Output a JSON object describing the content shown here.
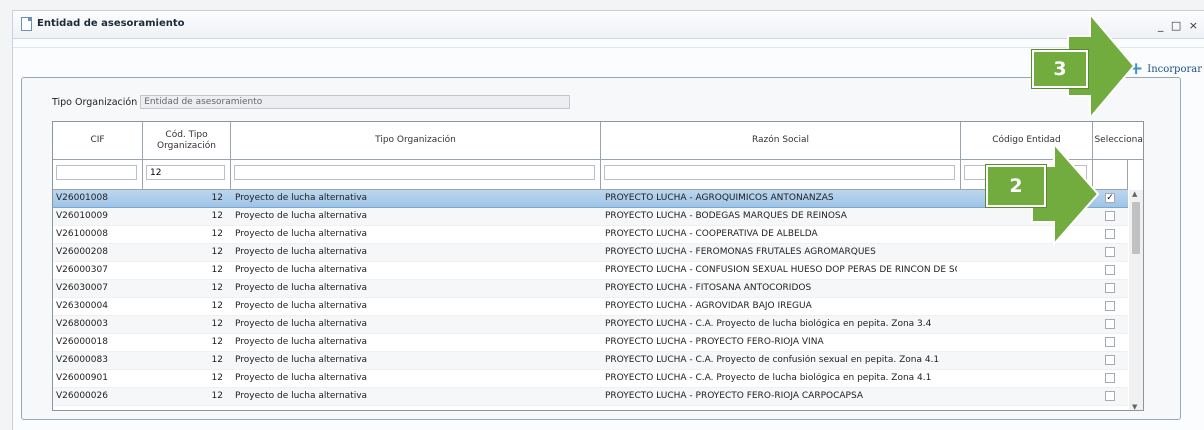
{
  "window": {
    "title": "Entidad de asesoramiento",
    "controls": [
      "_",
      "□",
      "×"
    ]
  },
  "toolbar": {
    "add_label": "Incorporar",
    "add_icon": "plus-icon"
  },
  "filter": {
    "label": "Tipo Organización",
    "value": "Entidad de asesoramiento"
  },
  "grid": {
    "columns": [
      "CIF",
      "Cód. Tipo Organización",
      "Tipo Organización",
      "Razón Social",
      "Código Entidad",
      "Seleccionar"
    ],
    "filters": {
      "cod_tipo": "12"
    },
    "rows": [
      {
        "cif": "V26001008",
        "cod": "12",
        "tipo": "Proyecto de lucha alternativa",
        "razon": "PROYECTO LUCHA - AGROQUÍMICOS ANTOÑANZAS",
        "codigo": "",
        "checked": true
      },
      {
        "cif": "V26010009",
        "cod": "12",
        "tipo": "Proyecto de lucha alternativa",
        "razon": "PROYECTO LUCHA - BODEGAS MARQUÉS DE REINOSA",
        "codigo": "",
        "checked": false
      },
      {
        "cif": "V26100008",
        "cod": "12",
        "tipo": "Proyecto de lucha alternativa",
        "razon": "PROYECTO LUCHA - COOPERATIVA DE ALBELDA",
        "codigo": "",
        "checked": false
      },
      {
        "cif": "V26000208",
        "cod": "12",
        "tipo": "Proyecto de lucha alternativa",
        "razon": "PROYECTO LUCHA - FEROMONAS FRUTALES AGROMARQUÉS",
        "codigo": "",
        "checked": false
      },
      {
        "cif": "V26000307",
        "cod": "12",
        "tipo": "Proyecto de lucha alternativa",
        "razon": "PROYECTO LUCHA - CONFUSION SEXUAL HUESO DOP PERAS DE RINCON DE SO",
        "codigo": "",
        "checked": false
      },
      {
        "cif": "V26030007",
        "cod": "12",
        "tipo": "Proyecto de lucha alternativa",
        "razon": "PROYECTO LUCHA - FITOSANA ANTOCÓRIDOS",
        "codigo": "",
        "checked": false
      },
      {
        "cif": "V26300004",
        "cod": "12",
        "tipo": "Proyecto de lucha alternativa",
        "razon": "PROYECTO LUCHA - AGROVIDAR BAJO IREGUA",
        "codigo": "",
        "checked": false
      },
      {
        "cif": "V26800003",
        "cod": "12",
        "tipo": "Proyecto de lucha alternativa",
        "razon": "PROYECTO LUCHA - C.A. Proyecto de lucha biológica en pepita. Zona 3.4",
        "codigo": "",
        "checked": false
      },
      {
        "cif": "V26000018",
        "cod": "12",
        "tipo": "Proyecto de lucha alternativa",
        "razon": "PROYECTO LUCHA - PROYECTO FERO-RIOJA VIÑA",
        "codigo": "",
        "checked": false
      },
      {
        "cif": "V26000083",
        "cod": "12",
        "tipo": "Proyecto de lucha alternativa",
        "razon": "PROYECTO LUCHA - C.A. Proyecto de confusión sexual en pepita. Zona 4.1",
        "codigo": "",
        "checked": false
      },
      {
        "cif": "V26000901",
        "cod": "12",
        "tipo": "Proyecto de lucha alternativa",
        "razon": "PROYECTO LUCHA - C.A. Proyecto de lucha biológica en pepita. Zona 4.1",
        "codigo": "",
        "checked": false
      },
      {
        "cif": "V26000026",
        "cod": "12",
        "tipo": "Proyecto de lucha alternativa",
        "razon": "PROYECTO LUCHA - PROYECTO FERO-RIOJA CARPOCAPSA",
        "codigo": "",
        "checked": false
      }
    ]
  },
  "annotations": [
    {
      "label": "3",
      "color": "#72ab3e"
    },
    {
      "label": "2",
      "color": "#72ab3e"
    }
  ]
}
